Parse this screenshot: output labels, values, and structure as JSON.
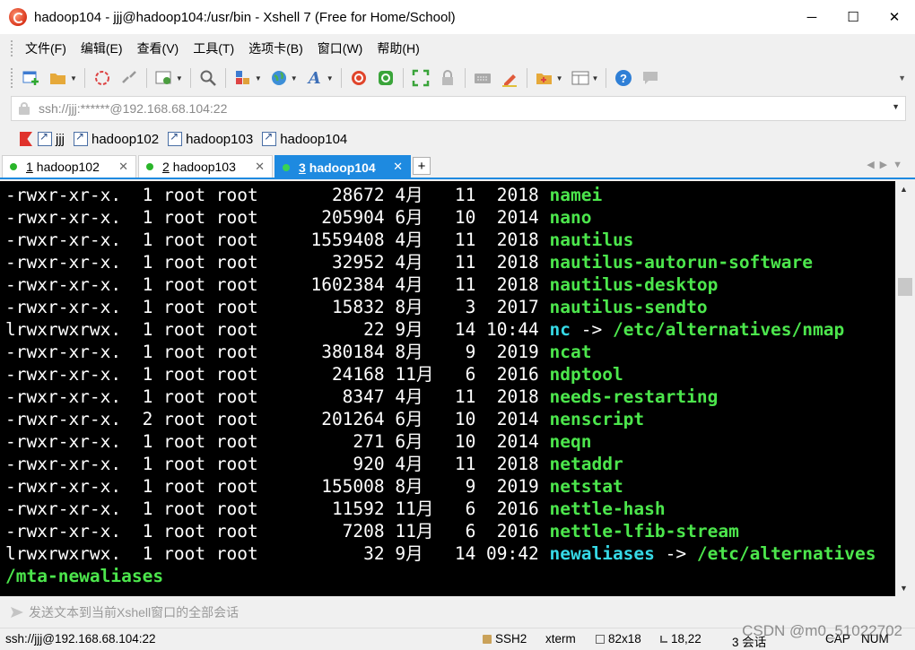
{
  "window": {
    "title": "hadoop104 - jjj@hadoop104:/usr/bin - Xshell 7 (Free for Home/School)",
    "minimize": "─",
    "maximize": "☐",
    "close": "✕"
  },
  "menu": [
    "文件(F)",
    "编辑(E)",
    "查看(V)",
    "工具(T)",
    "选项卡(B)",
    "窗口(W)",
    "帮助(H)"
  ],
  "address": {
    "value": "ssh://jjj:******@192.168.68.104:22"
  },
  "links": [
    "jjj",
    "hadoop102",
    "hadoop103",
    "hadoop104"
  ],
  "tabs": [
    {
      "num": "1",
      "label": "hadoop102",
      "status": "connected"
    },
    {
      "num": "2",
      "label": "hadoop103",
      "status": "connected"
    },
    {
      "num": "3",
      "label": "hadoop104",
      "status": "connected",
      "active": true
    }
  ],
  "terminal": {
    "lines": [
      {
        "perm": "-rwxr-xr-x.",
        "links": "1",
        "owner": "root",
        "group": "root",
        "size": "28672",
        "month": "4月",
        "day": "11",
        "time": "2018",
        "name": "namei",
        "kind": "exec"
      },
      {
        "perm": "-rwxr-xr-x.",
        "links": "1",
        "owner": "root",
        "group": "root",
        "size": "205904",
        "month": "6月",
        "day": "10",
        "time": "2014",
        "name": "nano",
        "kind": "exec"
      },
      {
        "perm": "-rwxr-xr-x.",
        "links": "1",
        "owner": "root",
        "group": "root",
        "size": "1559408",
        "month": "4月",
        "day": "11",
        "time": "2018",
        "name": "nautilus",
        "kind": "exec"
      },
      {
        "perm": "-rwxr-xr-x.",
        "links": "1",
        "owner": "root",
        "group": "root",
        "size": "32952",
        "month": "4月",
        "day": "11",
        "time": "2018",
        "name": "nautilus-autorun-software",
        "kind": "exec"
      },
      {
        "perm": "-rwxr-xr-x.",
        "links": "1",
        "owner": "root",
        "group": "root",
        "size": "1602384",
        "month": "4月",
        "day": "11",
        "time": "2018",
        "name": "nautilus-desktop",
        "kind": "exec"
      },
      {
        "perm": "-rwxr-xr-x.",
        "links": "1",
        "owner": "root",
        "group": "root",
        "size": "15832",
        "month": "8月",
        "day": "3",
        "time": "2017",
        "name": "nautilus-sendto",
        "kind": "exec"
      },
      {
        "perm": "lrwxrwxrwx.",
        "links": "1",
        "owner": "root",
        "group": "root",
        "size": "22",
        "month": "9月",
        "day": "14",
        "time": "10:44",
        "name": "nc",
        "kind": "link",
        "target": "/etc/alternatives/nmap"
      },
      {
        "perm": "-rwxr-xr-x.",
        "links": "1",
        "owner": "root",
        "group": "root",
        "size": "380184",
        "month": "8月",
        "day": "9",
        "time": "2019",
        "name": "ncat",
        "kind": "exec"
      },
      {
        "perm": "-rwxr-xr-x.",
        "links": "1",
        "owner": "root",
        "group": "root",
        "size": "24168",
        "month": "11月",
        "day": "6",
        "time": "2016",
        "name": "ndptool",
        "kind": "exec"
      },
      {
        "perm": "-rwxr-xr-x.",
        "links": "1",
        "owner": "root",
        "group": "root",
        "size": "8347",
        "month": "4月",
        "day": "11",
        "time": "2018",
        "name": "needs-restarting",
        "kind": "exec"
      },
      {
        "perm": "-rwxr-xr-x.",
        "links": "2",
        "owner": "root",
        "group": "root",
        "size": "201264",
        "month": "6月",
        "day": "10",
        "time": "2014",
        "name": "nenscript",
        "kind": "exec"
      },
      {
        "perm": "-rwxr-xr-x.",
        "links": "1",
        "owner": "root",
        "group": "root",
        "size": "271",
        "month": "6月",
        "day": "10",
        "time": "2014",
        "name": "neqn",
        "kind": "exec"
      },
      {
        "perm": "-rwxr-xr-x.",
        "links": "1",
        "owner": "root",
        "group": "root",
        "size": "920",
        "month": "4月",
        "day": "11",
        "time": "2018",
        "name": "netaddr",
        "kind": "exec"
      },
      {
        "perm": "-rwxr-xr-x.",
        "links": "1",
        "owner": "root",
        "group": "root",
        "size": "155008",
        "month": "8月",
        "day": "9",
        "time": "2019",
        "name": "netstat",
        "kind": "exec"
      },
      {
        "perm": "-rwxr-xr-x.",
        "links": "1",
        "owner": "root",
        "group": "root",
        "size": "11592",
        "month": "11月",
        "day": "6",
        "time": "2016",
        "name": "nettle-hash",
        "kind": "exec"
      },
      {
        "perm": "-rwxr-xr-x.",
        "links": "1",
        "owner": "root",
        "group": "root",
        "size": "7208",
        "month": "11月",
        "day": "6",
        "time": "2016",
        "name": "nettle-lfib-stream",
        "kind": "exec"
      },
      {
        "perm": "lrwxrwxrwx.",
        "links": "1",
        "owner": "root",
        "group": "root",
        "size": "32",
        "month": "9月",
        "day": "14",
        "time": "09:42",
        "name": "newaliases",
        "kind": "link",
        "target": "/etc/alternatives"
      }
    ],
    "wrapped_line": "/mta-newaliases"
  },
  "compose": {
    "placeholder": "发送文本到当前Xshell窗口的全部会话"
  },
  "status": {
    "connection": "ssh://jjj@192.168.68.104:22",
    "protocol": "SSH2",
    "term": "xterm",
    "size": "82x18",
    "cursor": "18,22",
    "sessions": "3 会话",
    "caps": "CAP",
    "num": "NUM"
  },
  "watermark": "CSDN @m0_51022702",
  "colors": {
    "terminal_bg": "#000000",
    "exec_file": "#4ce64c",
    "symlink": "#36d9e6",
    "active_tab": "#1e8ae0"
  }
}
